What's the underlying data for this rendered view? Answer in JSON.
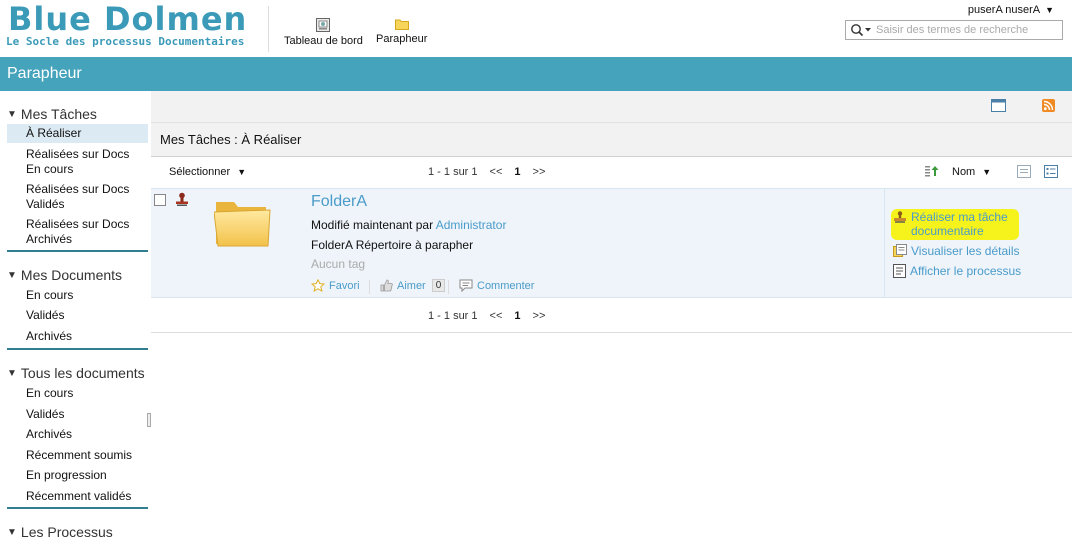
{
  "header": {
    "logo_title": "Blue Dolmen",
    "logo_subtitle": "Le Socle des processus Documentaires",
    "nav": [
      {
        "label": "Tableau de bord",
        "icon": "dashboard-icon"
      },
      {
        "label": "Parapheur",
        "icon": "folder-icon"
      }
    ],
    "user": "puserA nuserA",
    "search_placeholder": "Saisir des termes de recherche"
  },
  "banner": {
    "title": "Parapheur"
  },
  "sidebar": {
    "sections": [
      {
        "title": "Mes Tâches",
        "items": [
          {
            "label": "À Réaliser",
            "active": true
          },
          {
            "label": "Réalisées sur Docs En cours"
          },
          {
            "label": "Réalisées sur Docs Validés"
          },
          {
            "label": "Réalisées sur Docs Archivés"
          }
        ]
      },
      {
        "title": "Mes Documents",
        "items": [
          {
            "label": "En cours"
          },
          {
            "label": "Validés"
          },
          {
            "label": "Archivés"
          }
        ]
      },
      {
        "title": "Tous les documents",
        "items": [
          {
            "label": "En cours"
          },
          {
            "label": "Validés"
          },
          {
            "label": "Archivés"
          },
          {
            "label": "Récemment soumis"
          },
          {
            "label": "En progression"
          },
          {
            "label": "Récemment validés"
          }
        ]
      },
      {
        "title": "Les Processus",
        "items": []
      }
    ]
  },
  "main": {
    "breadcrumb": "Mes Tâches : À Réaliser",
    "select_label": "Sélectionner",
    "pager": {
      "range": "1 - 1 sur 1",
      "prev": "<<",
      "page": "1",
      "next": ">>"
    },
    "sort_label": "Nom",
    "document": {
      "title": "FolderA",
      "modified_prefix": "Modifié maintenant par",
      "modified_by": "Administrator",
      "description": "FolderA Répertoire à parapher",
      "tags": "Aucun tag",
      "favorite": "Favori",
      "like": "Aimer",
      "like_count": "0",
      "comment": "Commenter"
    },
    "side_actions": [
      {
        "label": "Réaliser ma tâche documentaire",
        "highlighted": true
      },
      {
        "label": "Visualiser les détails"
      },
      {
        "label": "Afficher le processus"
      }
    ]
  },
  "colors": {
    "banner": "#45a3bb",
    "link": "#4a9bc9",
    "highlight": "#f5f21c",
    "active_item": "#dceaf3"
  }
}
